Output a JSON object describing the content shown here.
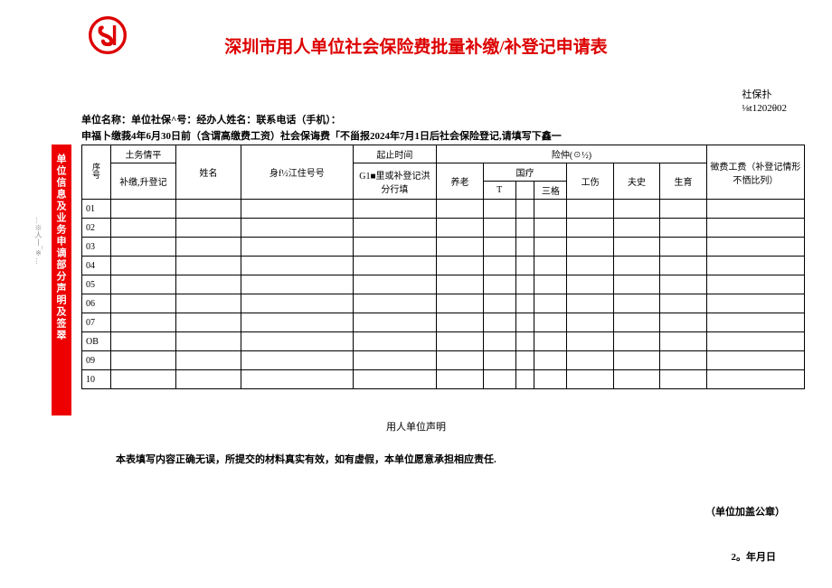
{
  "title": "深圳市用人单位社会保险费批量补缴/补登记申请表",
  "top_right_line1": "社保扑",
  "top_right_line2": "⅛t1202θ02",
  "info_line1": "单位名称：单位社保^号：经办人姓名：联系电话（手机）：",
  "info_line2": "申福卜缴莪4年6月30日前（含谓高缴费工资）社会保诲费「不甾报2024年7月1日后社会保险登记,请填写下鑫一",
  "sidebar_text": "单位信息及业务申谪部分声明及签翠",
  "sidebar_left": "…※人丨¯※…",
  "headers": {
    "seq": "序号",
    "type_line1": "土务情平",
    "type_line2": "补缴,升登记",
    "name": "姓名",
    "id": "身f½江住号号",
    "time_line1": "起止时间",
    "time_line2": "G1■里或补登记洪分行填",
    "insurance": "险仲(☉½)",
    "yang": "养老",
    "yiliao": "国疗",
    "yl_sub1": "T",
    "yl_sub2": "三格",
    "gong": "工伤",
    "shi": "夫史",
    "sheng": "生育",
    "wage": "徵费工费（补登记情形不恓比列）"
  },
  "rows": [
    "01",
    "02",
    "03",
    "04",
    "05",
    "06",
    "07",
    "OB",
    "09",
    "10"
  ],
  "declaration_title": "用人单位声明",
  "declaration_text": "本表填写内容正确无误，所提交的材料真实有效，如有虚假，本单位愿意承担相应责任.",
  "stamp_text": "（单位加盖公章）",
  "date_text": "2。年月日"
}
